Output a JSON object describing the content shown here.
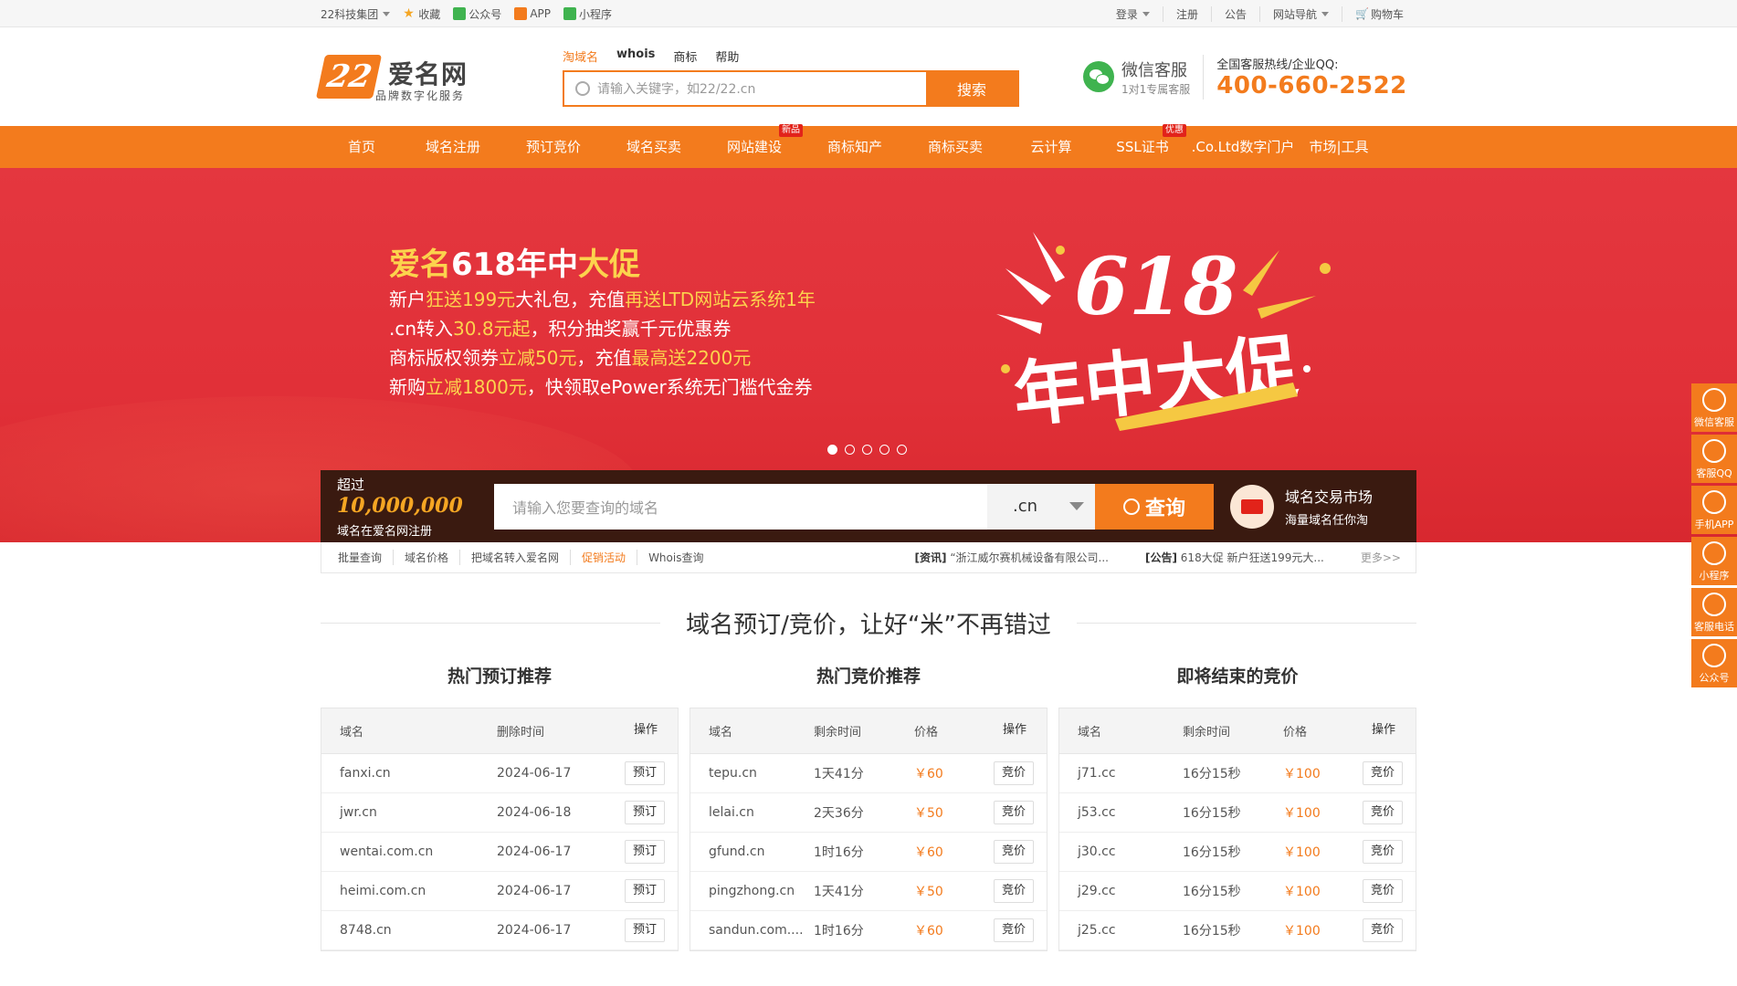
{
  "topbar": {
    "group": "22科技集团",
    "fav": "收藏",
    "gzh": "公众号",
    "app": "APP",
    "mini": "小程序",
    "login": "登录",
    "register": "注册",
    "notice": "公告",
    "sitenav": "网站导航",
    "cart": "购物车"
  },
  "header": {
    "logo_name": "爱名网",
    "logo_sub": "品牌数字化服务",
    "logo_mark": "22",
    "search_tabs": [
      "淘域名",
      "whois",
      "商标",
      "帮助"
    ],
    "search_placeholder": "请输入关键字，如22/22.cn",
    "search_button": "搜索",
    "kefu_title": "微信客服",
    "kefu_sub": "1对1专属客服",
    "hotline_label": "全国客服热线/企业QQ:",
    "hotline_number": "400-660-2522"
  },
  "nav": {
    "items": [
      {
        "label": "首页",
        "badge": ""
      },
      {
        "label": "域名注册",
        "badge": ""
      },
      {
        "label": "预订竞价",
        "badge": ""
      },
      {
        "label": "域名买卖",
        "badge": ""
      },
      {
        "label": "网站建设",
        "badge": "新品"
      },
      {
        "label": "商标知产",
        "badge": ""
      },
      {
        "label": "商标买卖",
        "badge": ""
      },
      {
        "label": "云计算",
        "badge": ""
      },
      {
        "label": "SSL证书",
        "badge": "优惠"
      },
      {
        "label": ".Co.Ltd数字门户",
        "badge": ""
      },
      {
        "label": "市场|工具",
        "badge": ""
      }
    ]
  },
  "banner": {
    "title_a": "爱名",
    "title_b": "618年中",
    "title_c": "大促",
    "l1a": "新户",
    "l1b": "狂送199元",
    "l1c": "大礼包，充值",
    "l1d": "再送LTD网站云系统1年",
    "l2a": ".cn转入",
    "l2b": "30.8元起",
    "l2c": "，积分抽奖赢千元优惠券",
    "l3a": "商标版权领券",
    "l3b": "立减50元",
    "l3c": "，充值",
    "l3d": "最高送2200元",
    "l4a": "新购",
    "l4b": "立减1800元",
    "l4c": "，快领取ePower系统无门槛代金券",
    "art_top": "618",
    "art_bottom": "年中大促"
  },
  "domain_search": {
    "over_label": "超过",
    "count": "10,000,000",
    "sub": "域名在爱名网注册",
    "placeholder": "请输入您要查询的域名",
    "suffix": ".cn",
    "button": "查询",
    "market_title": "域名交易市场",
    "market_sub": "海量域名任你淘"
  },
  "quick_links": {
    "items": [
      "批量查询",
      "域名价格",
      "把域名转入爱名网",
      "促销活动",
      "Whois查询"
    ],
    "news1_tag": "[资讯]",
    "news1": "“浙江威尔赛机械设备有限公司...",
    "news2_tag": "[公告]",
    "news2": "618大促 新户狂送199元大...",
    "more": "更多>>"
  },
  "section": {
    "title": "域名预订/竞价，让好“米”不再错过"
  },
  "col1": {
    "title": "热门预订推荐",
    "headers": [
      "域名",
      "删除时间",
      "操作"
    ],
    "rows": [
      {
        "d": "fanxi.cn",
        "t": "2024-06-17",
        "op": "预订"
      },
      {
        "d": "jwr.cn",
        "t": "2024-06-18",
        "op": "预订"
      },
      {
        "d": "wentai.com.cn",
        "t": "2024-06-17",
        "op": "预订"
      },
      {
        "d": "heimi.com.cn",
        "t": "2024-06-17",
        "op": "预订"
      },
      {
        "d": "8748.cn",
        "t": "2024-06-17",
        "op": "预订"
      }
    ]
  },
  "col2": {
    "title": "热门竞价推荐",
    "headers": [
      "域名",
      "剩余时间",
      "价格",
      "操作"
    ],
    "rows": [
      {
        "d": "tepu.cn",
        "t": "1天41分",
        "p": "￥60",
        "op": "竞价"
      },
      {
        "d": "lelai.cn",
        "t": "2天36分",
        "p": "￥50",
        "op": "竞价"
      },
      {
        "d": "gfund.cn",
        "t": "1时16分",
        "p": "￥60",
        "op": "竞价"
      },
      {
        "d": "pingzhong.cn",
        "t": "1天41分",
        "p": "￥50",
        "op": "竞价"
      },
      {
        "d": "sandun.com....",
        "t": "1时16分",
        "p": "￥60",
        "op": "竞价"
      }
    ]
  },
  "col3": {
    "title": "即将结束的竞价",
    "headers": [
      "域名",
      "剩余时间",
      "价格",
      "操作"
    ],
    "rows": [
      {
        "d": "j71.cc",
        "t": "16分15秒",
        "p": "￥100",
        "op": "竞价"
      },
      {
        "d": "j53.cc",
        "t": "16分15秒",
        "p": "￥100",
        "op": "竞价"
      },
      {
        "d": "j30.cc",
        "t": "16分15秒",
        "p": "￥100",
        "op": "竞价"
      },
      {
        "d": "j29.cc",
        "t": "16分15秒",
        "p": "￥100",
        "op": "竞价"
      },
      {
        "d": "j25.cc",
        "t": "16分15秒",
        "p": "￥100",
        "op": "竞价"
      }
    ]
  },
  "sidebar": {
    "items": [
      "微信客服",
      "客服QQ",
      "手机APP",
      "小程序",
      "客服电话",
      "公众号"
    ]
  },
  "colors": {
    "brand": "#f37b1d",
    "banner_red": "#e13038",
    "highlight_yellow": "#fcd34d"
  }
}
